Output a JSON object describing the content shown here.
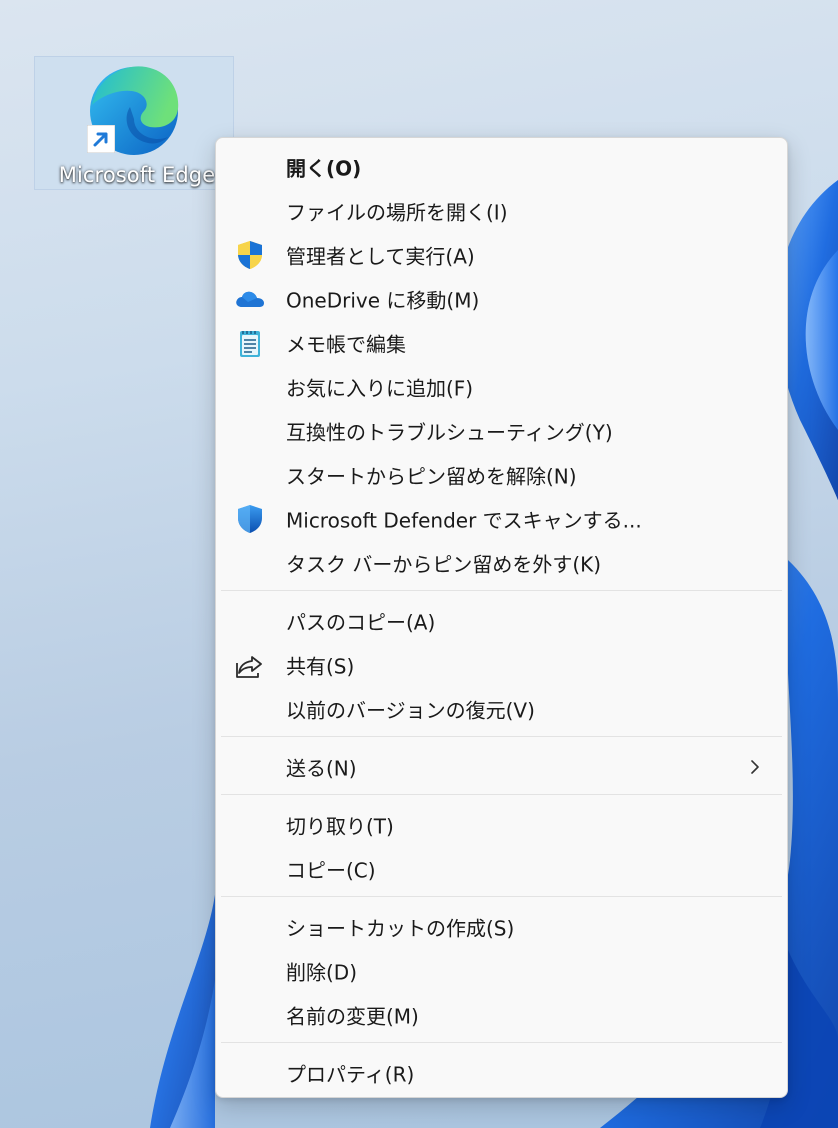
{
  "desktop": {
    "icon_label": "Microsoft Edge"
  },
  "menu": {
    "groups": [
      {
        "items": [
          {
            "label": "開く(O)",
            "icon": null,
            "bold": true
          },
          {
            "label": "ファイルの場所を開く(I)",
            "icon": null
          },
          {
            "label": "管理者として実行(A)",
            "icon": "uac-shield-icon"
          },
          {
            "label": "OneDrive に移動(M)",
            "icon": "onedrive-cloud-icon"
          },
          {
            "label": "メモ帳で編集",
            "icon": "notepad-icon"
          },
          {
            "label": "お気に入りに追加(F)",
            "icon": null
          },
          {
            "label": "互換性のトラブルシューティング(Y)",
            "icon": null
          },
          {
            "label": "スタートからピン留めを解除(N)",
            "icon": null
          },
          {
            "label": "Microsoft Defender でスキャンする...",
            "icon": "defender-shield-icon"
          },
          {
            "label": "タスク バーからピン留めを外す(K)",
            "icon": null
          }
        ]
      },
      {
        "items": [
          {
            "label": "パスのコピー(A)",
            "icon": null
          },
          {
            "label": "共有(S)",
            "icon": "share-icon"
          },
          {
            "label": "以前のバージョンの復元(V)",
            "icon": null
          }
        ]
      },
      {
        "items": [
          {
            "label": "送る(N)",
            "icon": null,
            "submenu": true
          }
        ]
      },
      {
        "items": [
          {
            "label": "切り取り(T)",
            "icon": null
          },
          {
            "label": "コピー(C)",
            "icon": null
          }
        ]
      },
      {
        "items": [
          {
            "label": "ショートカットの作成(S)",
            "icon": null
          },
          {
            "label": "削除(D)",
            "icon": null
          },
          {
            "label": "名前の変更(M)",
            "icon": null
          }
        ]
      },
      {
        "items": [
          {
            "label": "プロパティ(R)",
            "icon": null
          }
        ]
      }
    ]
  },
  "colors": {
    "menu_background": "#f9f9f9",
    "menu_text": "#1a1a1a",
    "separator": "#e3e3e3",
    "wallpaper_accent": "#1a6fe0"
  }
}
